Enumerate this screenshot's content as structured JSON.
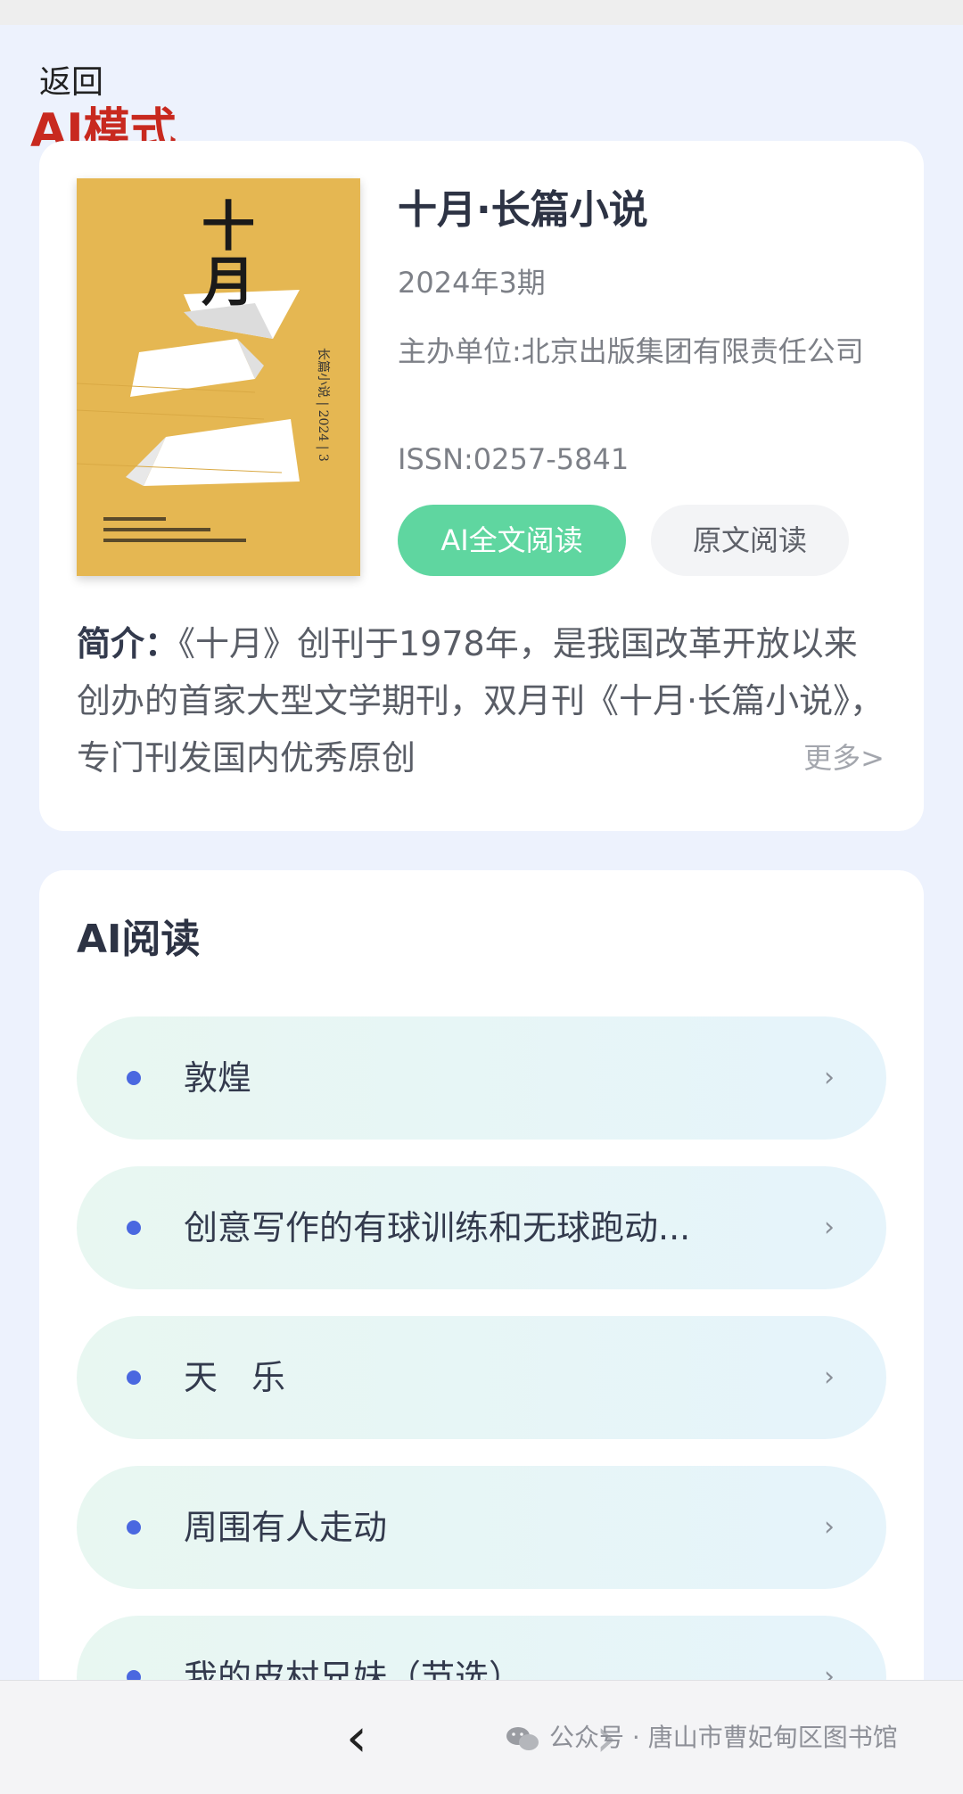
{
  "header": {
    "back_label": "返回",
    "mode_label": "AI模式"
  },
  "book": {
    "cover_text": "十月",
    "cover_icon": "magazine-cover-image",
    "title": "十月·长篇小说",
    "issue": "2024年3期",
    "publisher": "主办单位:北京出版集团有限责任公司",
    "issn": "ISSN:0257-5841",
    "ai_read_label": "AI全文阅读",
    "original_read_label": "原文阅读",
    "intro_label": "简介：",
    "intro_text": "《十月》创刊于1978年，是我国改革开放以来创办的首家大型文学期刊，双月刊《十月·长篇小说》，专门刊发国内优秀原创",
    "more_label": "更多>"
  },
  "ai_reading": {
    "title": "AI阅读",
    "chapters": [
      {
        "title": "敦煌"
      },
      {
        "title": "创意写作的有球训练和无球跑动..."
      },
      {
        "title": "天　乐"
      },
      {
        "title": "周围有人走动"
      },
      {
        "title": "我的皮村兄妹（节选）"
      }
    ]
  },
  "bottom_bar": {
    "back_icon": "chevron-left-icon",
    "forward_icon": "chevron-right-icon",
    "watermark": "公众号 · 唐山市曹妃甸区图书馆",
    "watermark_icon": "wechat-icon"
  },
  "colors": {
    "background": "#edf2fd",
    "accent_green": "#5fd6a0",
    "mode_red": "#c8291f",
    "bullet_blue": "#4a68e0",
    "cover_gold": "#e5b752"
  }
}
